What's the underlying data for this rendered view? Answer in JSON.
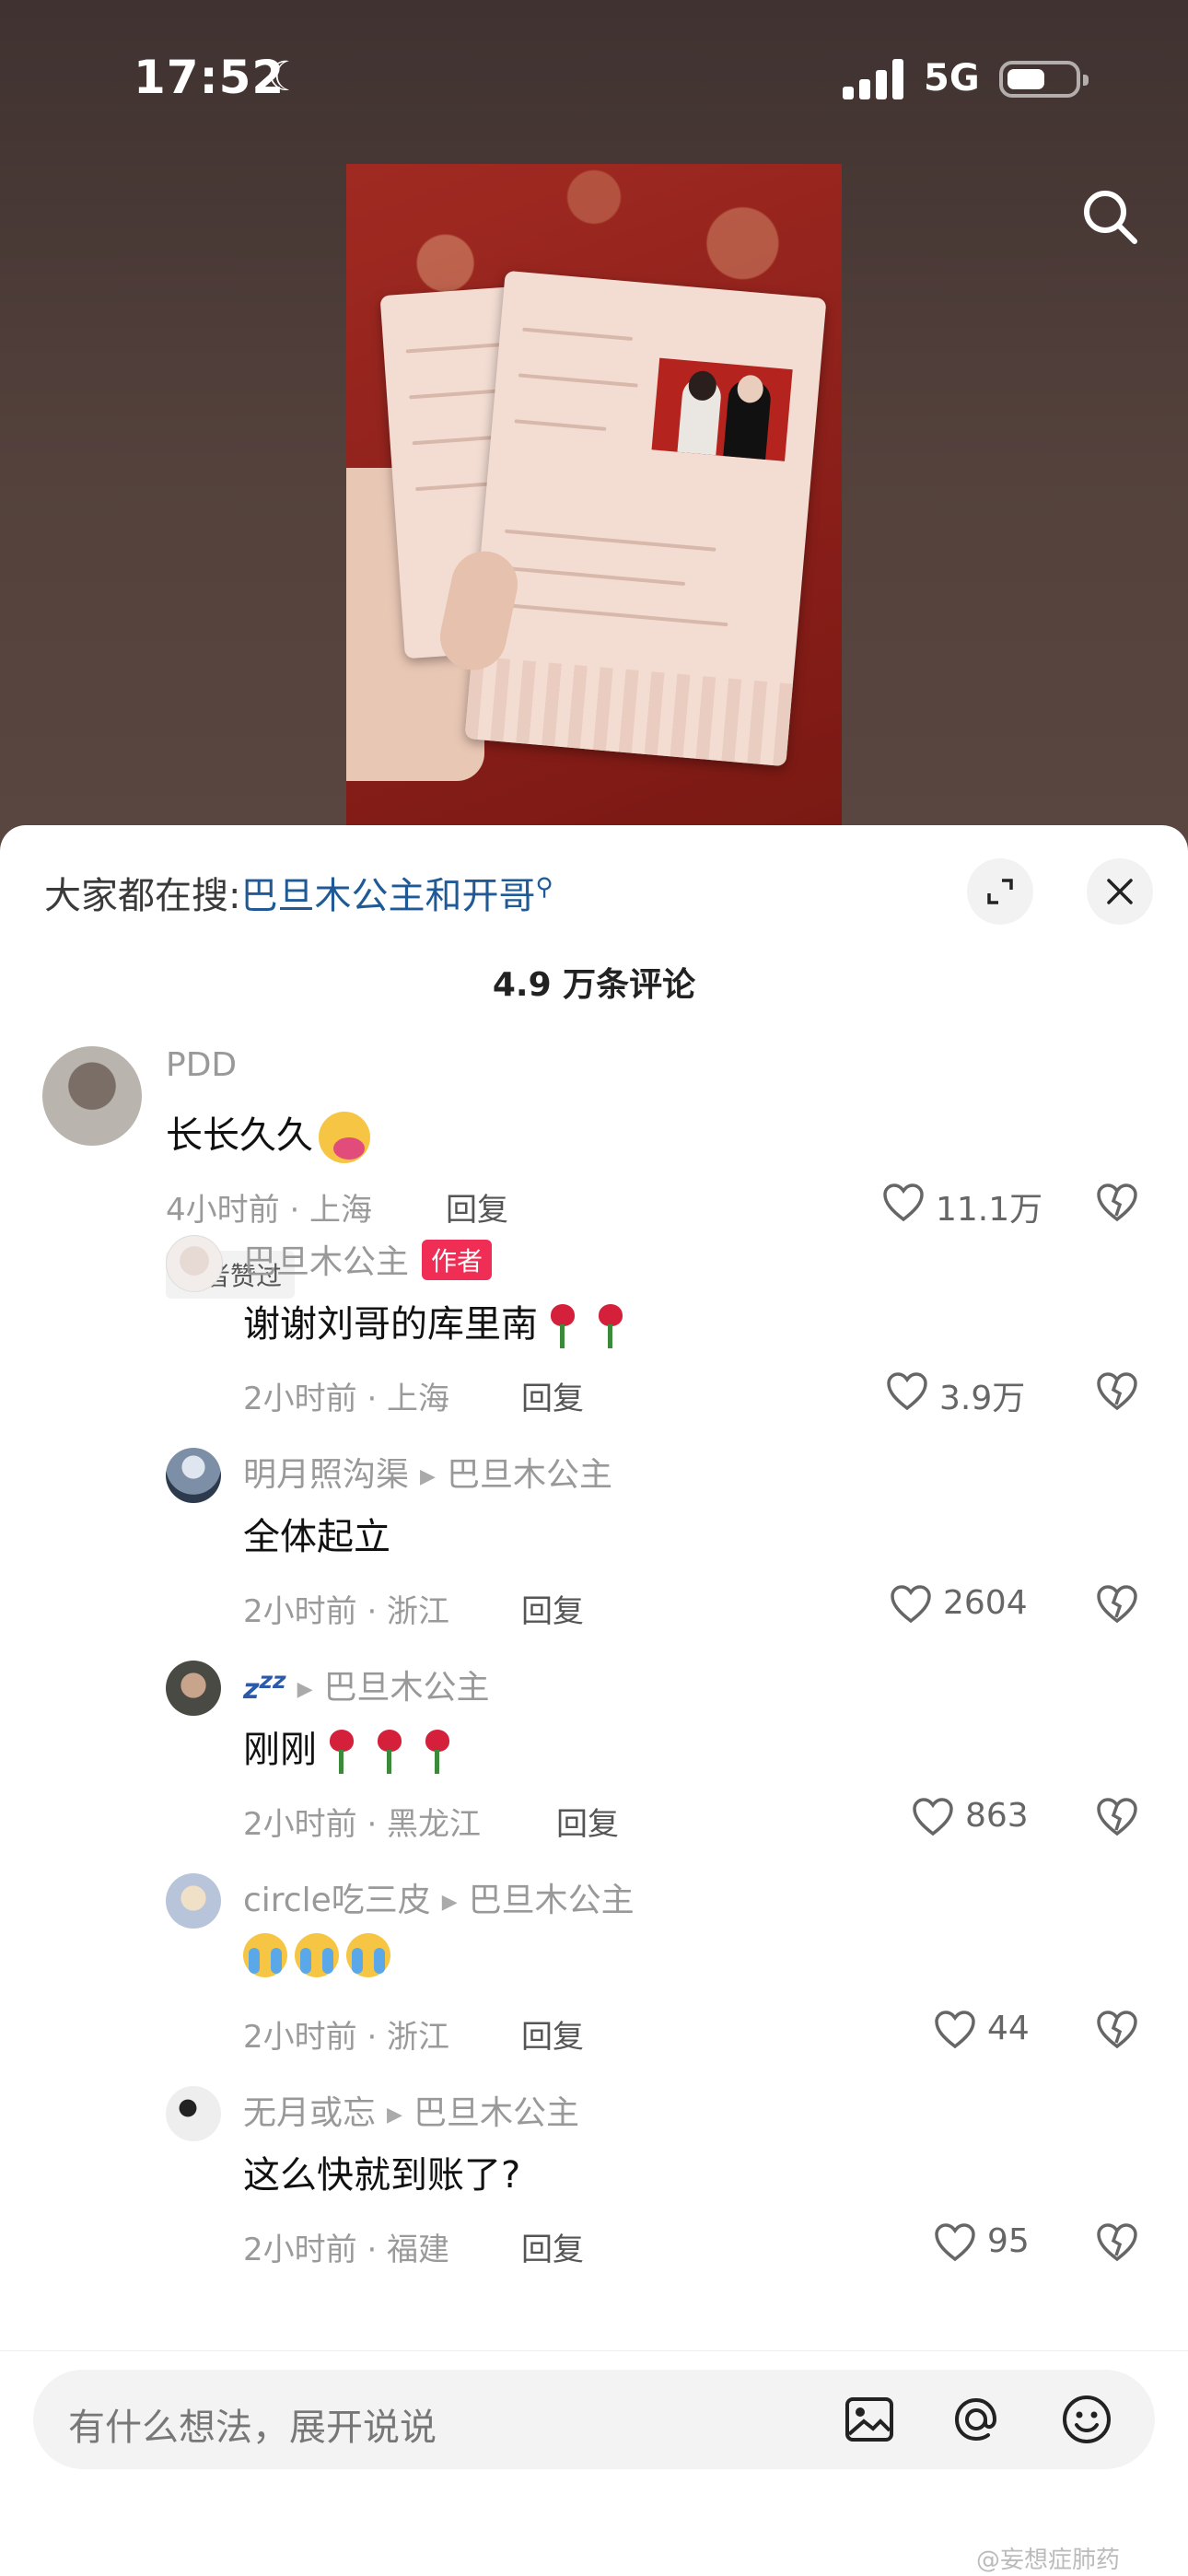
{
  "status_bar": {
    "time": "17:52",
    "network": "5G",
    "battery_level_pct": 55
  },
  "video": {
    "search_icon": "search-icon"
  },
  "sheet": {
    "hot_search_prefix": "大家都在搜:",
    "hot_search_term": "巴旦木公主和开哥",
    "comment_count": "4.9 万条评论"
  },
  "comments": [
    {
      "username": "PDD",
      "text": "长长久久",
      "time_location": "4小时前 · 上海",
      "reply_label": "回复",
      "likes": "11.1万",
      "badge": "作者赞过"
    },
    {
      "username": "巴旦木公主",
      "author_tag": "作者",
      "text": "谢谢刘哥的库里南",
      "time_location": "2小时前 · 上海",
      "reply_label": "回复",
      "likes": "3.9万"
    },
    {
      "username": "明月照沟渠",
      "reply_to": "巴旦木公主",
      "text": "全体起立",
      "time_location": "2小时前 · 浙江",
      "reply_label": "回复",
      "likes": "2604"
    },
    {
      "username": "zzz",
      "reply_to": "巴旦木公主",
      "text": "刚刚",
      "time_location": "2小时前 · 黑龙江",
      "reply_label": "回复",
      "likes": "863"
    },
    {
      "username": "circle吃三皮",
      "reply_to": "巴旦木公主",
      "text": "",
      "time_location": "2小时前 · 浙江",
      "reply_label": "回复",
      "likes": "44"
    },
    {
      "username": "无月或忘",
      "reply_to": "巴旦木公主",
      "text": "这么快就到账了?",
      "time_location": "2小时前 · 福建",
      "reply_label": "回复",
      "likes": "95"
    }
  ],
  "input": {
    "placeholder": "有什么想法，展开说说"
  },
  "watermark": "@妄想症肺药"
}
